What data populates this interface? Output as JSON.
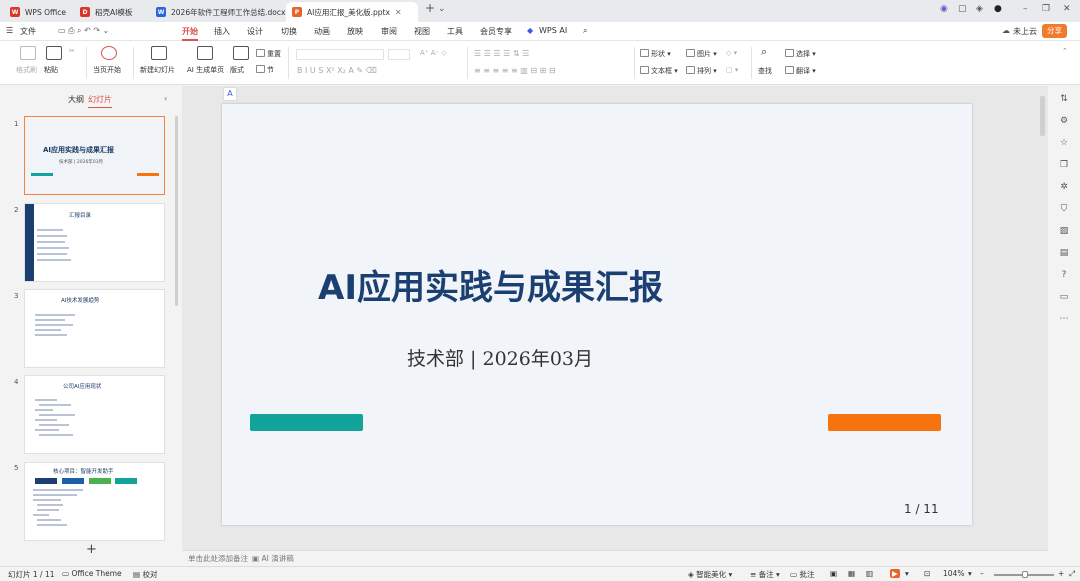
{
  "tabs": [
    {
      "label": "WPS Office",
      "color": "#d9362b",
      "glyph": "W"
    },
    {
      "label": "稻壳AI模板",
      "color": "#d9362b",
      "glyph": "D"
    },
    {
      "label": "2026年软件工程师工作总结.docx",
      "color": "#2b65d9",
      "glyph": "W"
    },
    {
      "label": "AI应用汇报_美化版.pptx",
      "color": "#e8652a",
      "glyph": "P"
    }
  ],
  "menu": {
    "file": "文件",
    "items": [
      "开始",
      "插入",
      "设计",
      "切换",
      "动画",
      "放映",
      "审阅",
      "视图",
      "工具",
      "会员专享"
    ],
    "wps_ai": "WPS AI",
    "cloud": "未上云",
    "share": "分享"
  },
  "ribbon": {
    "format_painter": "格式刷",
    "paste": "粘贴",
    "from_current": "当页开始",
    "new_slide": "新建幻灯片",
    "ai_slide": "AI 生成单页",
    "layout": "版式",
    "reset": "重置",
    "section": "节",
    "shape": "形状",
    "picture": "图片",
    "textbox": "文本框",
    "arrange": "排列",
    "find": "查找",
    "select": "选择",
    "translate": "翻译"
  },
  "panel": {
    "outline": "大纲",
    "slides": "幻灯片"
  },
  "thumbs": [
    {
      "num": "1",
      "title": "AI应用实践与成果汇报",
      "sub": "技术部 | 2026年03月"
    },
    {
      "num": "2",
      "title": "汇报目录"
    },
    {
      "num": "3",
      "title": "AI技术发展趋势"
    },
    {
      "num": "4",
      "title": "公司AI应用现状"
    },
    {
      "num": "5",
      "title": "核心项目：智能开发助手"
    }
  ],
  "slide": {
    "title": "AI应用实践与成果汇报",
    "subtitle": "技术部 | 2026年03月",
    "page": "1 / 11"
  },
  "notes": {
    "placeholder": "单击此处添加备注",
    "ai_speaker": "AI 演讲稿"
  },
  "status": {
    "slide_count": "幻灯片 1 / 11",
    "theme": "Office Theme",
    "proofread": "校对",
    "beautify": "智能美化",
    "notes": "备注",
    "comment": "批注",
    "zoom": "104%"
  }
}
